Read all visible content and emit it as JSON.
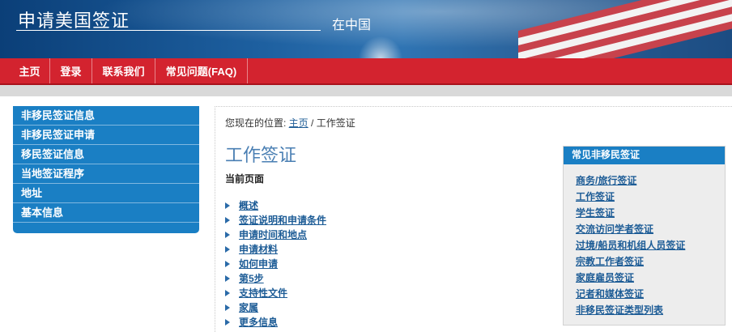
{
  "header": {
    "title": "申请美国签证",
    "subtitle": "在中国"
  },
  "nav": {
    "items": [
      {
        "label": "主页"
      },
      {
        "label": "登录"
      },
      {
        "label": "联系我们"
      },
      {
        "label": "常见问题(FAQ)"
      }
    ]
  },
  "sidebar": {
    "items": [
      {
        "label": "非移民签证信息"
      },
      {
        "label": "非移民签证申请"
      },
      {
        "label": "移民签证信息"
      },
      {
        "label": "当地签证程序"
      },
      {
        "label": "地址"
      },
      {
        "label": "基本信息"
      }
    ]
  },
  "breadcrumb": {
    "prefix": "您现在的位置: ",
    "home": "主页",
    "separator": " / ",
    "current": "工作签证"
  },
  "main": {
    "title": "工作签证",
    "current_page_label": "当前页面",
    "links": [
      {
        "label": "概述"
      },
      {
        "label": "签证说明和申请条件"
      },
      {
        "label": "申请时间和地点"
      },
      {
        "label": "申请材料"
      },
      {
        "label": "如何申请"
      },
      {
        "label": "第5步"
      },
      {
        "label": "支持性文件"
      },
      {
        "label": "家属"
      },
      {
        "label": "更多信息"
      }
    ]
  },
  "faq_box": {
    "title": "常见非移民签证",
    "links": [
      {
        "label": "商务/旅行签证"
      },
      {
        "label": "工作签证"
      },
      {
        "label": "学生签证"
      },
      {
        "label": "交流访问学者签证"
      },
      {
        "label": "过境/船员和机组人员签证"
      },
      {
        "label": "宗教工作者签证"
      },
      {
        "label": "家庭雇员签证"
      },
      {
        "label": "记者和媒体签证"
      },
      {
        "label": "非移民签证类型列表"
      }
    ]
  },
  "colors": {
    "nav_red": "#d3232f",
    "sidebar_blue": "#1a7fc4",
    "link_blue": "#1d5c96"
  }
}
